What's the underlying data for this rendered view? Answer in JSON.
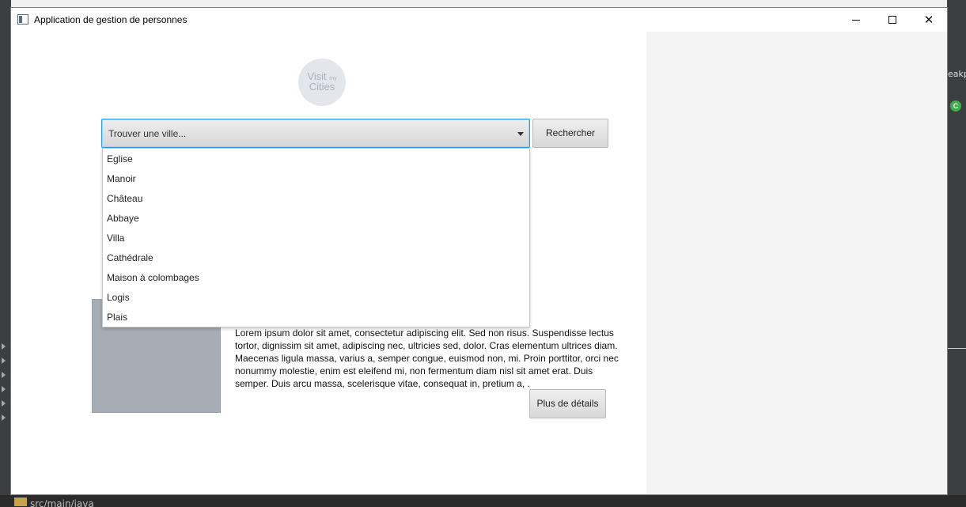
{
  "window": {
    "title": "Application de gestion de personnes",
    "minimize_label": "—",
    "close_label": "✕"
  },
  "logo": {
    "line1": "Visit",
    "line1_small": "my",
    "line2": "Cities"
  },
  "search": {
    "combo_value": "Trouver une ville...",
    "button_label": "Rechercher",
    "options": [
      "Eglise",
      "Manoir",
      "Château",
      "Abbaye",
      "Villa",
      "Cathédrale",
      "Maison à colombages",
      "Logis",
      "Plais"
    ]
  },
  "result": {
    "description": "Lorem ipsum dolor sit amet, consectetur adipiscing elit. Sed non risus. Suspendisse lectus tortor, dignissim sit amet, adipiscing nec, ultricies sed, dolor. Cras elementum ultrices diam. Maecenas ligula massa, varius a, semper congue, euismod non, mi. Proin porttitor, orci nec nonummy molestie, enim est eleifend mi, non fermentum diam nisl sit amet erat. Duis semper. Duis arcu massa, scelerisque vitae, consequat in, pretium a, .",
    "details_button": "Plus de détails"
  },
  "ide": {
    "bottom_path": "src/main/java",
    "right_text": "eakpo",
    "badge": "C"
  }
}
